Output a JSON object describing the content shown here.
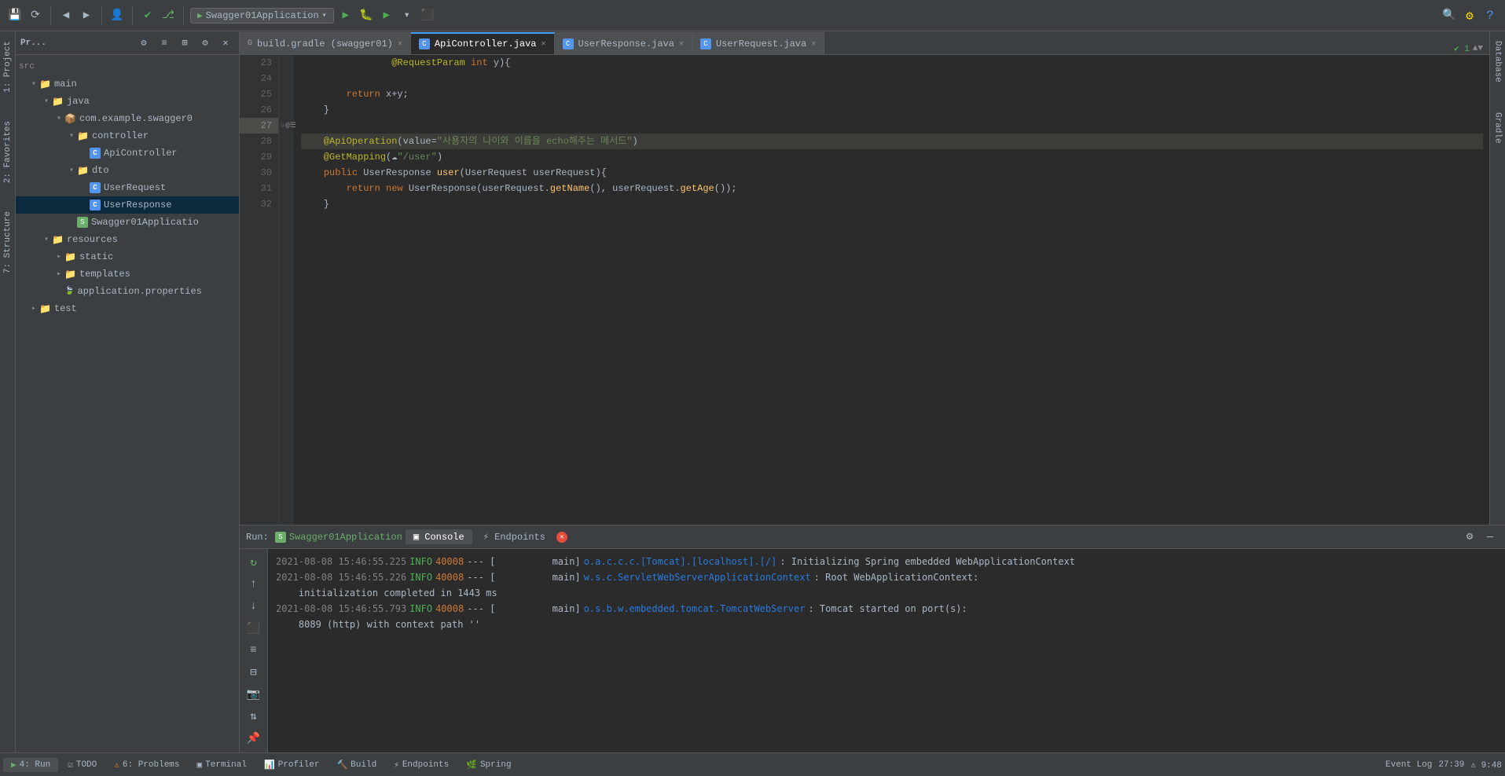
{
  "toolbar": {
    "run_config": "Swagger01Application",
    "icons": [
      "⬆",
      "💾",
      "🔄",
      "◀",
      "▶",
      "👤",
      "✔",
      "🌿",
      "▶",
      "🔴"
    ]
  },
  "tabs": {
    "items": [
      {
        "label": "build.gradle (swagger01)",
        "icon": "gradle",
        "active": false
      },
      {
        "label": "ApiController.java",
        "icon": "java",
        "active": true
      },
      {
        "label": "UserResponse.java",
        "icon": "java",
        "active": false
      },
      {
        "label": "UserRequest.java",
        "icon": "java",
        "active": false
      }
    ]
  },
  "project_tree": {
    "title": "Pr...",
    "items": [
      {
        "label": "src",
        "level": 0,
        "type": "text"
      },
      {
        "label": "main",
        "level": 1,
        "type": "folder",
        "expanded": true
      },
      {
        "label": "java",
        "level": 2,
        "type": "folder",
        "expanded": true
      },
      {
        "label": "com.example.swagger0",
        "level": 3,
        "type": "folder",
        "expanded": true
      },
      {
        "label": "controller",
        "level": 4,
        "type": "folder",
        "expanded": true
      },
      {
        "label": "ApiController",
        "level": 5,
        "type": "java"
      },
      {
        "label": "dto",
        "level": 4,
        "type": "folder",
        "expanded": true
      },
      {
        "label": "UserRequest",
        "level": 5,
        "type": "java"
      },
      {
        "label": "UserResponse",
        "level": 5,
        "type": "java",
        "selected": true
      },
      {
        "label": "Swagger01Applicatio",
        "level": 4,
        "type": "spring"
      },
      {
        "label": "resources",
        "level": 2,
        "type": "folder",
        "expanded": true
      },
      {
        "label": "static",
        "level": 3,
        "type": "folder"
      },
      {
        "label": "templates",
        "level": 3,
        "type": "folder"
      },
      {
        "label": "application.properties",
        "level": 3,
        "type": "props"
      }
    ],
    "test_item": {
      "label": "test",
      "level": 1,
      "type": "folder"
    }
  },
  "code_lines": [
    {
      "num": 23,
      "content": "                @RequestParam int y){",
      "highlighted": false
    },
    {
      "num": 24,
      "content": "",
      "highlighted": false
    },
    {
      "num": 24,
      "tokens": [
        {
          "text": "        return ",
          "cls": "kw"
        },
        {
          "text": "x+y;",
          "cls": "plain"
        }
      ],
      "highlighted": false
    },
    {
      "num": 25,
      "content": "    }",
      "highlighted": false
    },
    {
      "num": 26,
      "content": "",
      "highlighted": false
    },
    {
      "num": 27,
      "highlighted": true
    },
    {
      "num": 28,
      "highlighted": false
    },
    {
      "num": 29,
      "highlighted": false
    },
    {
      "num": 30,
      "highlighted": false
    },
    {
      "num": 31,
      "highlighted": false
    },
    {
      "num": 32,
      "content": "",
      "highlighted": false
    }
  ],
  "bottom_run": {
    "label": "Run:",
    "app_name": "Swagger01Application",
    "tabs": [
      "Console",
      "Endpoints"
    ]
  },
  "console_logs": [
    {
      "time": "2021-08-08 15:46:55.225",
      "level": "INFO",
      "pid": "40008",
      "thread": "main]",
      "class": "o.a.c.c.c.[Tomcat].[localhost].[/]",
      "msg": "  : Initializing Spring embedded WebApplicationContext"
    },
    {
      "time": "2021-08-08 15:46:55.226",
      "level": "INFO",
      "pid": "40008",
      "thread": "main]",
      "class": "w.s.c.ServletWebServerApplicationContext",
      "msg": " : Root WebApplicationContext: initialization completed in 1443 ms"
    },
    {
      "time": "2021-08-08 15:46:55.793",
      "level": "INFO",
      "pid": "40008",
      "thread": "main]",
      "class": "o.s.b.w.embedded.tomcat.TomcatWebServer",
      "msg": " : Tomcat started on port(s): 8089 (http) with context path ''"
    }
  ],
  "bottom_bar": {
    "tabs": [
      {
        "label": "4: Run",
        "icon": "▶",
        "active": true
      },
      {
        "label": "TODO",
        "icon": "≡"
      },
      {
        "label": "6: Problems",
        "icon": "⚠"
      },
      {
        "label": "Terminal",
        "icon": "▣"
      },
      {
        "label": "Profiler",
        "icon": "📊"
      },
      {
        "label": "Build",
        "icon": "🔨"
      },
      {
        "label": "Endpoints",
        "icon": "⚡"
      },
      {
        "label": "Spring",
        "icon": "🌿"
      }
    ],
    "right": {
      "event_log": "Event Log",
      "time": "27:39",
      "memory": "9:48"
    }
  },
  "right_sidebar": {
    "tabs": [
      "Database",
      "Gradle"
    ]
  },
  "left_vtabs": [
    "1: Project",
    "2: Favorites",
    "7: Structure"
  ]
}
